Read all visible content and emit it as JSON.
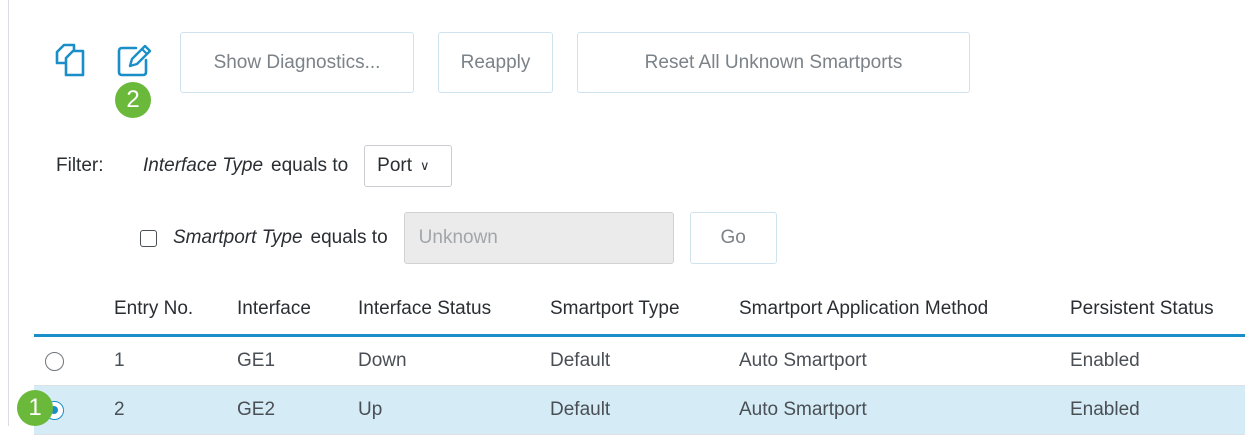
{
  "toolbar": {
    "copy_icon": "copy-icon",
    "edit_icon": "edit-icon",
    "show_diagnostics_label": "Show Diagnostics...",
    "reapply_label": "Reapply",
    "reset_label": "Reset All Unknown Smartports"
  },
  "badges": {
    "edit_step": "2",
    "row_step": "1",
    "color": "#6bb93a"
  },
  "filter": {
    "label": "Filter:",
    "field": "Interface Type",
    "operator": "equals to",
    "value": "Port",
    "smartport_field": "Smartport Type",
    "smartport_operator": "equals to",
    "smartport_value": "Unknown",
    "smartport_checked": false,
    "go_label": "Go"
  },
  "table": {
    "accent": "#1a8ec8",
    "columns": [
      "Entry No.",
      "Interface",
      "Interface Status",
      "Smartport Type",
      "Smartport Application Method",
      "Persistent Status"
    ],
    "rows": [
      {
        "selected": false,
        "entry": "1",
        "interface": "GE1",
        "status": "Down",
        "smartport_type": "Default",
        "method": "Auto Smartport",
        "persistent": "Enabled"
      },
      {
        "selected": true,
        "entry": "2",
        "interface": "GE2",
        "status": "Up",
        "smartport_type": "Default",
        "method": "Auto Smartport",
        "persistent": "Enabled"
      }
    ]
  }
}
